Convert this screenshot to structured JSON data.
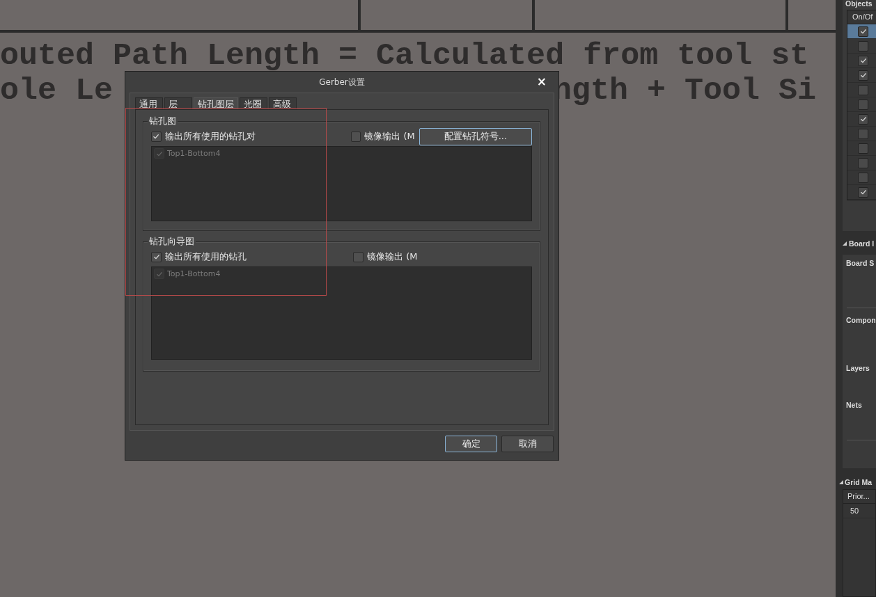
{
  "canvas_text": [
    {
      "text": "outed Path Length = Calculated from tool st"
    },
    {
      "text": "ole Le"
    },
    {
      "text": "ngth + Tool Si"
    }
  ],
  "dialog": {
    "title": "Gerber设置",
    "close": "×",
    "tabs": [
      {
        "label": "通用",
        "selected": false
      },
      {
        "label": "层",
        "selected": false
      },
      {
        "label": "钻孔图层",
        "selected": true
      },
      {
        "label": "光圈",
        "selected": false
      },
      {
        "label": "高级",
        "selected": false
      }
    ],
    "groups": [
      {
        "title": "钻孔图",
        "output_all": {
          "label": "输出所有使用的钻孔对",
          "checked": true
        },
        "mirror": {
          "label": "镜像输出 (M",
          "checked": false
        },
        "button": {
          "label": "配置钻孔符号...",
          "highlighted": true
        },
        "list": [
          {
            "label": "Top1-Bottom4",
            "checked": true,
            "disabled": true
          }
        ]
      },
      {
        "title": "钻孔向导图",
        "output_all": {
          "label": "输出所有使用的钻孔",
          "checked": true
        },
        "mirror": {
          "label": "镜像输出 (M",
          "checked": false
        },
        "list": [
          {
            "label": "Top1-Bottom4",
            "checked": true,
            "disabled": true
          }
        ]
      }
    ],
    "buttons": [
      {
        "label": "确定",
        "highlighted": true
      },
      {
        "label": "取消",
        "highlighted": false
      }
    ]
  },
  "side_panel": {
    "objects": {
      "title": "Objects",
      "header": "On/Of",
      "rows": [
        {
          "checked": true,
          "selected": true
        },
        {
          "checked": false,
          "selected": false
        },
        {
          "checked": true,
          "selected": false
        },
        {
          "checked": true,
          "selected": false
        },
        {
          "checked": false,
          "selected": false
        },
        {
          "checked": false,
          "selected": false
        },
        {
          "checked": true,
          "selected": false
        },
        {
          "checked": false,
          "selected": false
        },
        {
          "checked": false,
          "selected": false
        },
        {
          "checked": false,
          "selected": false
        },
        {
          "checked": false,
          "selected": false
        },
        {
          "checked": true,
          "selected": false
        }
      ]
    },
    "board_info": {
      "title": "Board I",
      "labels": [
        "Board S",
        "Compon",
        "Layers",
        "Nets"
      ]
    },
    "grid": {
      "title": "Grid Ma",
      "header": "Prior...",
      "rows": [
        "50"
      ]
    }
  }
}
